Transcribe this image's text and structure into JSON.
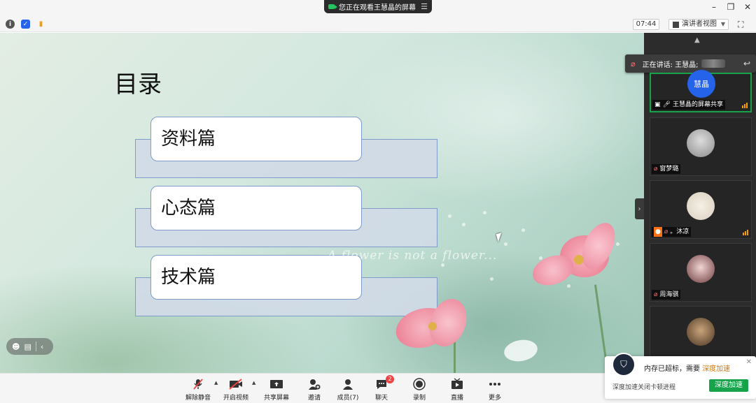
{
  "window": {
    "share_banner": "您正在观看王慧晶的屏幕",
    "controls": {
      "minimize": "–",
      "restore": "❐",
      "close": "✕"
    }
  },
  "toolbar": {
    "timer": "07:44",
    "view_mode": "演讲者视图"
  },
  "slide": {
    "title": "目录",
    "items": [
      "资料篇",
      "心态篇",
      "技术篇"
    ],
    "script_text": "A flower is not a flower..."
  },
  "participants": {
    "speaking_label": "正在讲话: 王慧晶;",
    "tiles": [
      {
        "avatar_text": "慧晶",
        "name": "王慧晶的屏幕共享",
        "active": true
      },
      {
        "name": "窗梦璐"
      },
      {
        "name": "。沐凉"
      },
      {
        "name": "周海骐"
      },
      {
        "name": ""
      }
    ]
  },
  "bottombar": {
    "unmute": "解除静音",
    "start_video": "开启视频",
    "share_screen": "共享屏幕",
    "invite": "邀请",
    "members": "成员(7)",
    "chat": "聊天",
    "chat_badge": "2",
    "record": "录制",
    "live": "直播",
    "more": "更多"
  },
  "notification": {
    "message_prefix": "内存已超标，需要",
    "message_accent": "深度加速",
    "sub": "深度加速关闭卡顿进程",
    "button": "深度加速",
    "close": "✕"
  },
  "colors": {
    "accent_green": "#16a34a",
    "muted_red": "#ef4444",
    "warning_orange": "#d97706"
  }
}
